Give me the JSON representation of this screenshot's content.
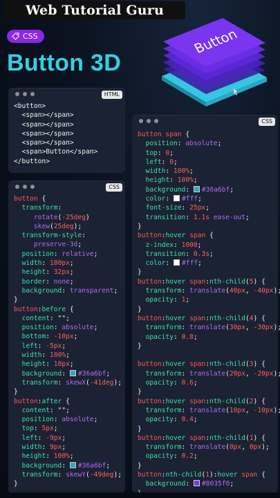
{
  "header": {
    "site_title": "Web Tutorial Guru",
    "tag_label": "CSS",
    "headline": "Button 3D"
  },
  "hero": {
    "button_text": "Button",
    "colors": {
      "layer": "#7a2ef0",
      "base": "#36a6bf"
    }
  },
  "panels": {
    "html": {
      "badge": "HTML"
    },
    "css_left": {
      "badge": "CSS"
    },
    "css_right": {
      "badge": "CSS"
    }
  },
  "colors": {
    "swatch_cyan": "#36a6bf",
    "swatch_white": "#fff",
    "swatch_purple": "#8035f0"
  }
}
